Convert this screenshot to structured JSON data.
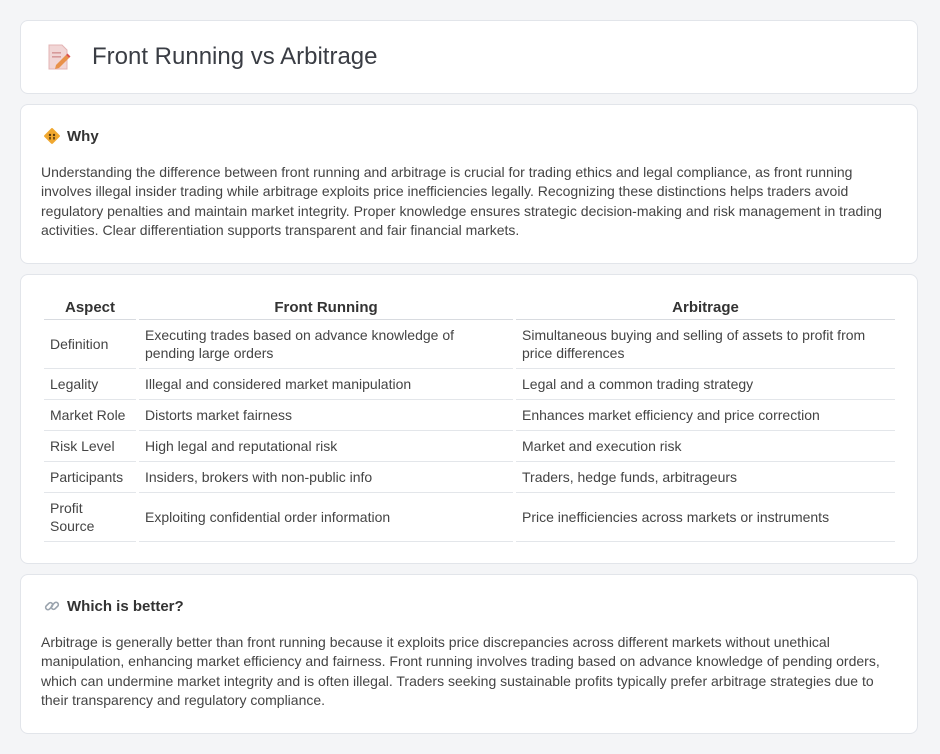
{
  "header": {
    "title": "Front Running vs Arbitrage",
    "icon": "document-pencil-icon"
  },
  "why": {
    "heading": "Why",
    "icon": "diamond-road-sign-icon",
    "text": "Understanding the difference between front running and arbitrage is crucial for trading ethics and legal compliance, as front running involves illegal insider trading while arbitrage exploits price inefficiencies legally. Recognizing these distinctions helps traders avoid regulatory penalties and maintain market integrity. Proper knowledge ensures strategic decision-making and risk management in trading activities. Clear differentiation supports transparent and fair financial markets."
  },
  "table": {
    "headers": [
      "Aspect",
      "Front Running",
      "Arbitrage"
    ],
    "rows": [
      [
        "Definition",
        "Executing trades based on advance knowledge of pending large orders",
        "Simultaneous buying and selling of assets to profit from price differences"
      ],
      [
        "Legality",
        "Illegal and considered market manipulation",
        "Legal and a common trading strategy"
      ],
      [
        "Market Role",
        "Distorts market fairness",
        "Enhances market efficiency and price correction"
      ],
      [
        "Risk Level",
        "High legal and reputational risk",
        "Market and execution risk"
      ],
      [
        "Participants",
        "Insiders, brokers with non-public info",
        "Traders, hedge funds, arbitrageurs"
      ],
      [
        "Profit Source",
        "Exploiting confidential order information",
        "Price inefficiencies across markets or instruments"
      ]
    ]
  },
  "better": {
    "heading": "Which is better?",
    "icon": "link-icon",
    "text": "Arbitrage is generally better than front running because it exploits price discrepancies across different markets without unethical manipulation, enhancing market efficiency and fairness. Front running involves trading based on advance knowledge of pending orders, which can undermine market integrity and is often illegal. Traders seeking sustainable profits typically prefer arbitrage strategies due to their transparency and regulatory compliance."
  }
}
